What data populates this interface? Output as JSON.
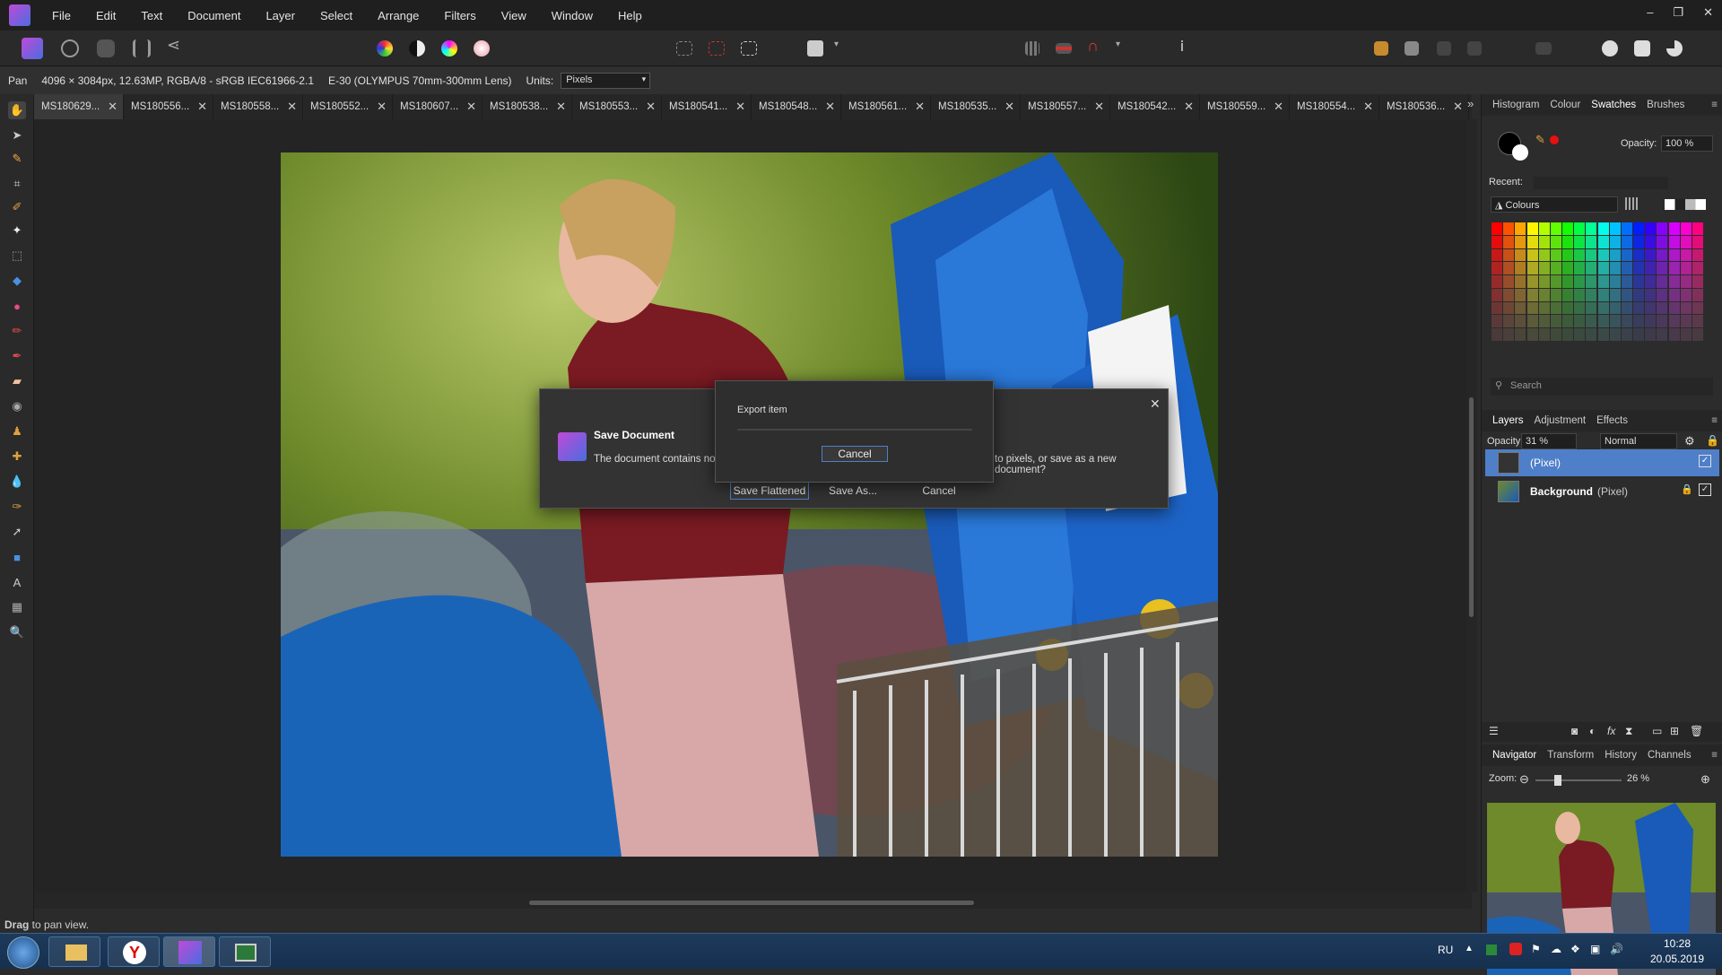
{
  "menubar": {
    "items": [
      "File",
      "Edit",
      "Text",
      "Document",
      "Layer",
      "Select",
      "Arrange",
      "Filters",
      "View",
      "Window",
      "Help"
    ],
    "window_controls": [
      "–",
      "❐",
      "✕"
    ]
  },
  "context_bar": {
    "tool": "Pan",
    "doc_info": "4096 × 3084px, 12.63MP, RGBA/8 - sRGB IEC61966-2.1",
    "lens": "E-30 (OLYMPUS 70mm-300mm Lens)",
    "units_label": "Units:",
    "units_value": "Pixels"
  },
  "tabs": [
    {
      "label": "MS180629...",
      "active": true
    },
    {
      "label": "MS180556..."
    },
    {
      "label": "MS180558..."
    },
    {
      "label": "MS180552..."
    },
    {
      "label": "MS180607..."
    },
    {
      "label": "MS180538..."
    },
    {
      "label": "MS180553..."
    },
    {
      "label": "MS180541..."
    },
    {
      "label": "MS180548..."
    },
    {
      "label": "MS180561..."
    },
    {
      "label": "MS180535..."
    },
    {
      "label": "MS180557..."
    },
    {
      "label": "MS180542..."
    },
    {
      "label": "MS180559..."
    },
    {
      "label": "MS180554..."
    },
    {
      "label": "MS180536..."
    }
  ],
  "tabs_overflow": "»",
  "status": {
    "bold": "Drag",
    "rest": " to pan view."
  },
  "swatch_panel": {
    "tabs": [
      "Histogram",
      "Colour",
      "Swatches",
      "Brushes"
    ],
    "active_tab": "Swatches",
    "opacity_label": "Opacity:",
    "opacity_value": "100 %",
    "recent_label": "Recent:",
    "palette_name": "Colours",
    "search_placeholder": "Search",
    "primary_color": "#000000",
    "secondary_color": "#ffffff",
    "accent_color": "#e81010"
  },
  "layers_panel": {
    "tabs": [
      "Layers",
      "Adjustment",
      "Effects"
    ],
    "active_tab": "Layers",
    "opacity_label": "Opacity:",
    "opacity_value": "31 %",
    "blend_mode": "Normal",
    "layers": [
      {
        "name": "(Pixel)",
        "selected": true,
        "locked": false
      },
      {
        "name": "Background",
        "type": "(Pixel)",
        "selected": false,
        "locked": true
      }
    ]
  },
  "navigator_panel": {
    "tabs": [
      "Navigator",
      "Transform",
      "History",
      "Channels"
    ],
    "active_tab": "Navigator",
    "zoom_label": "Zoom:",
    "zoom_value": "26 %",
    "zoom_level": 0.26
  },
  "save_dialog": {
    "title": "Save Document",
    "message_left": "The document contains non",
    "message_right": "to pixels, or save as a new document?",
    "buttons": [
      "Save Flattened",
      "Save As...",
      "Cancel"
    ]
  },
  "export_dialog": {
    "title": "Export item",
    "cancel": "Cancel"
  },
  "taskbar": {
    "language": "RU",
    "time": "10:28",
    "date": "20.05.2019"
  },
  "colors": {
    "accent_select": "#4f7fc9",
    "app_icon": "#b04fd6"
  }
}
